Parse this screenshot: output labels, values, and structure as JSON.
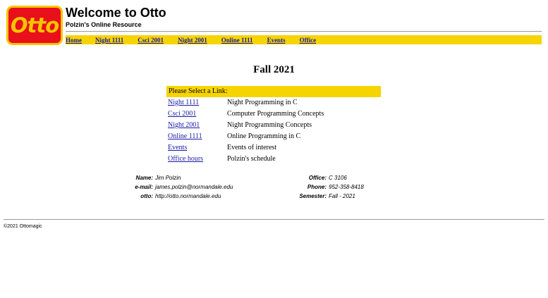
{
  "header": {
    "logo_text": "Otto",
    "title": "Welcome to Otto",
    "subtitle": "Polzin's Online Resource"
  },
  "nav": {
    "items": [
      "Home",
      "Night 1111",
      "Csci 2001",
      "Night 2001",
      "Online 1111",
      "Events",
      "Office"
    ]
  },
  "main": {
    "term": "Fall 2021",
    "table_header": "Please Select a Link:",
    "links": [
      {
        "label": "Night 1111",
        "desc": "Night Programming in C"
      },
      {
        "label": "Csci 2001",
        "desc": "Computer Programming Concepts"
      },
      {
        "label": "Night 2001",
        "desc": "Night Programming Concepts"
      },
      {
        "label": "Online 1111",
        "desc": "Online Programming in C"
      },
      {
        "label": "Events",
        "desc": "Events of interest"
      },
      {
        "label": "Office hours",
        "desc": "Polzin's schedule"
      }
    ]
  },
  "contact": {
    "left": [
      {
        "label": "Name:",
        "value": "Jim Polzin"
      },
      {
        "label": "e-mail:",
        "value": "james.polzin@normandale.edu"
      },
      {
        "label": "otto:",
        "value": "http://otto.normandale.edu"
      }
    ],
    "right": [
      {
        "label": "Office:",
        "value": "C 3106"
      },
      {
        "label": "Phone:",
        "value": "952-358-8418"
      },
      {
        "label": "Semester:",
        "value": "Fall - 2021"
      }
    ]
  },
  "footer": {
    "copyright": "©2021 Ottomagic"
  },
  "colors": {
    "accent_yellow": "#f6d400",
    "logo_red": "#e8101a",
    "link_blue": "#1a1aa6"
  }
}
